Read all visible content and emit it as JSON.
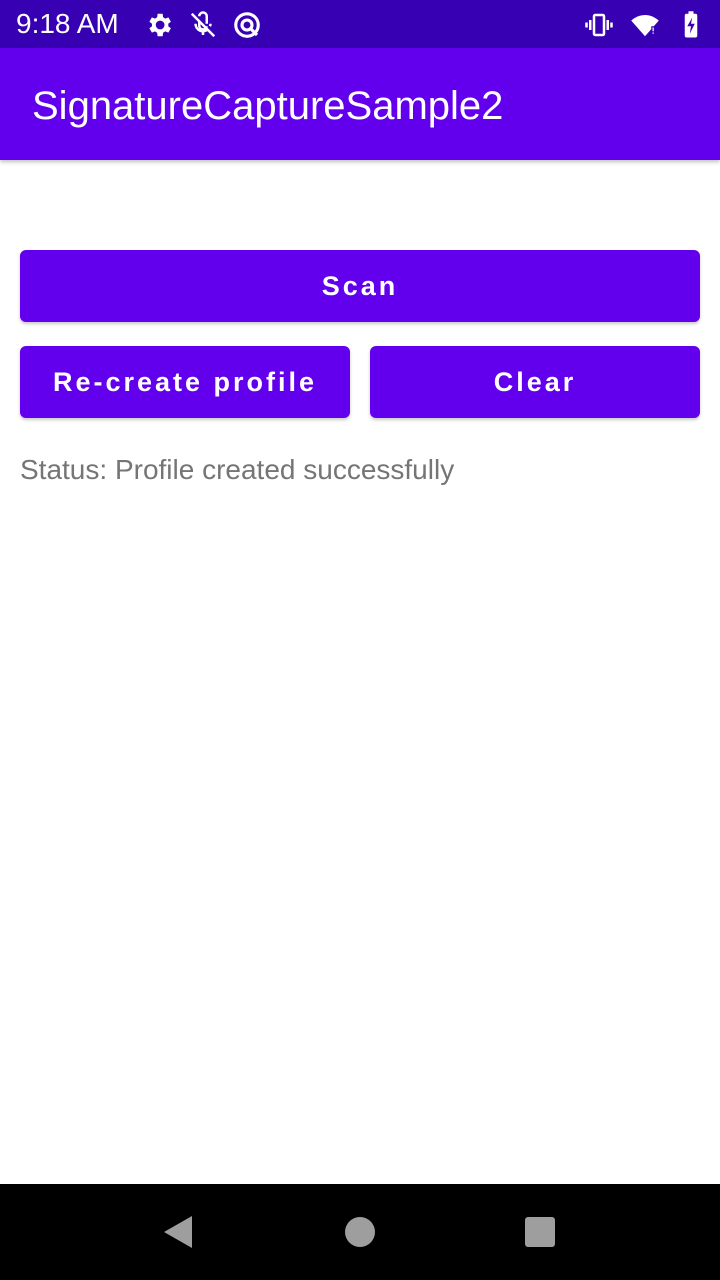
{
  "status_bar": {
    "time": "9:18 AM",
    "icons_left": [
      "gear-icon",
      "mic-off-icon",
      "data-saver-icon"
    ],
    "icons_right": [
      "vibrate-icon",
      "wifi-icon",
      "battery-charging-icon"
    ]
  },
  "app_bar": {
    "title": "SignatureCaptureSample2",
    "color": "#6200ee"
  },
  "buttons": {
    "scan": "Scan",
    "recreate_profile": "Re-create profile",
    "clear": "Clear"
  },
  "status_text": "Status: Profile created successfully",
  "nav_bar": {
    "icons": [
      "back-icon",
      "home-icon",
      "recents-icon"
    ]
  },
  "colors": {
    "status_bar": "#3700b3",
    "primary": "#6200ee",
    "status_text": "#757575"
  }
}
